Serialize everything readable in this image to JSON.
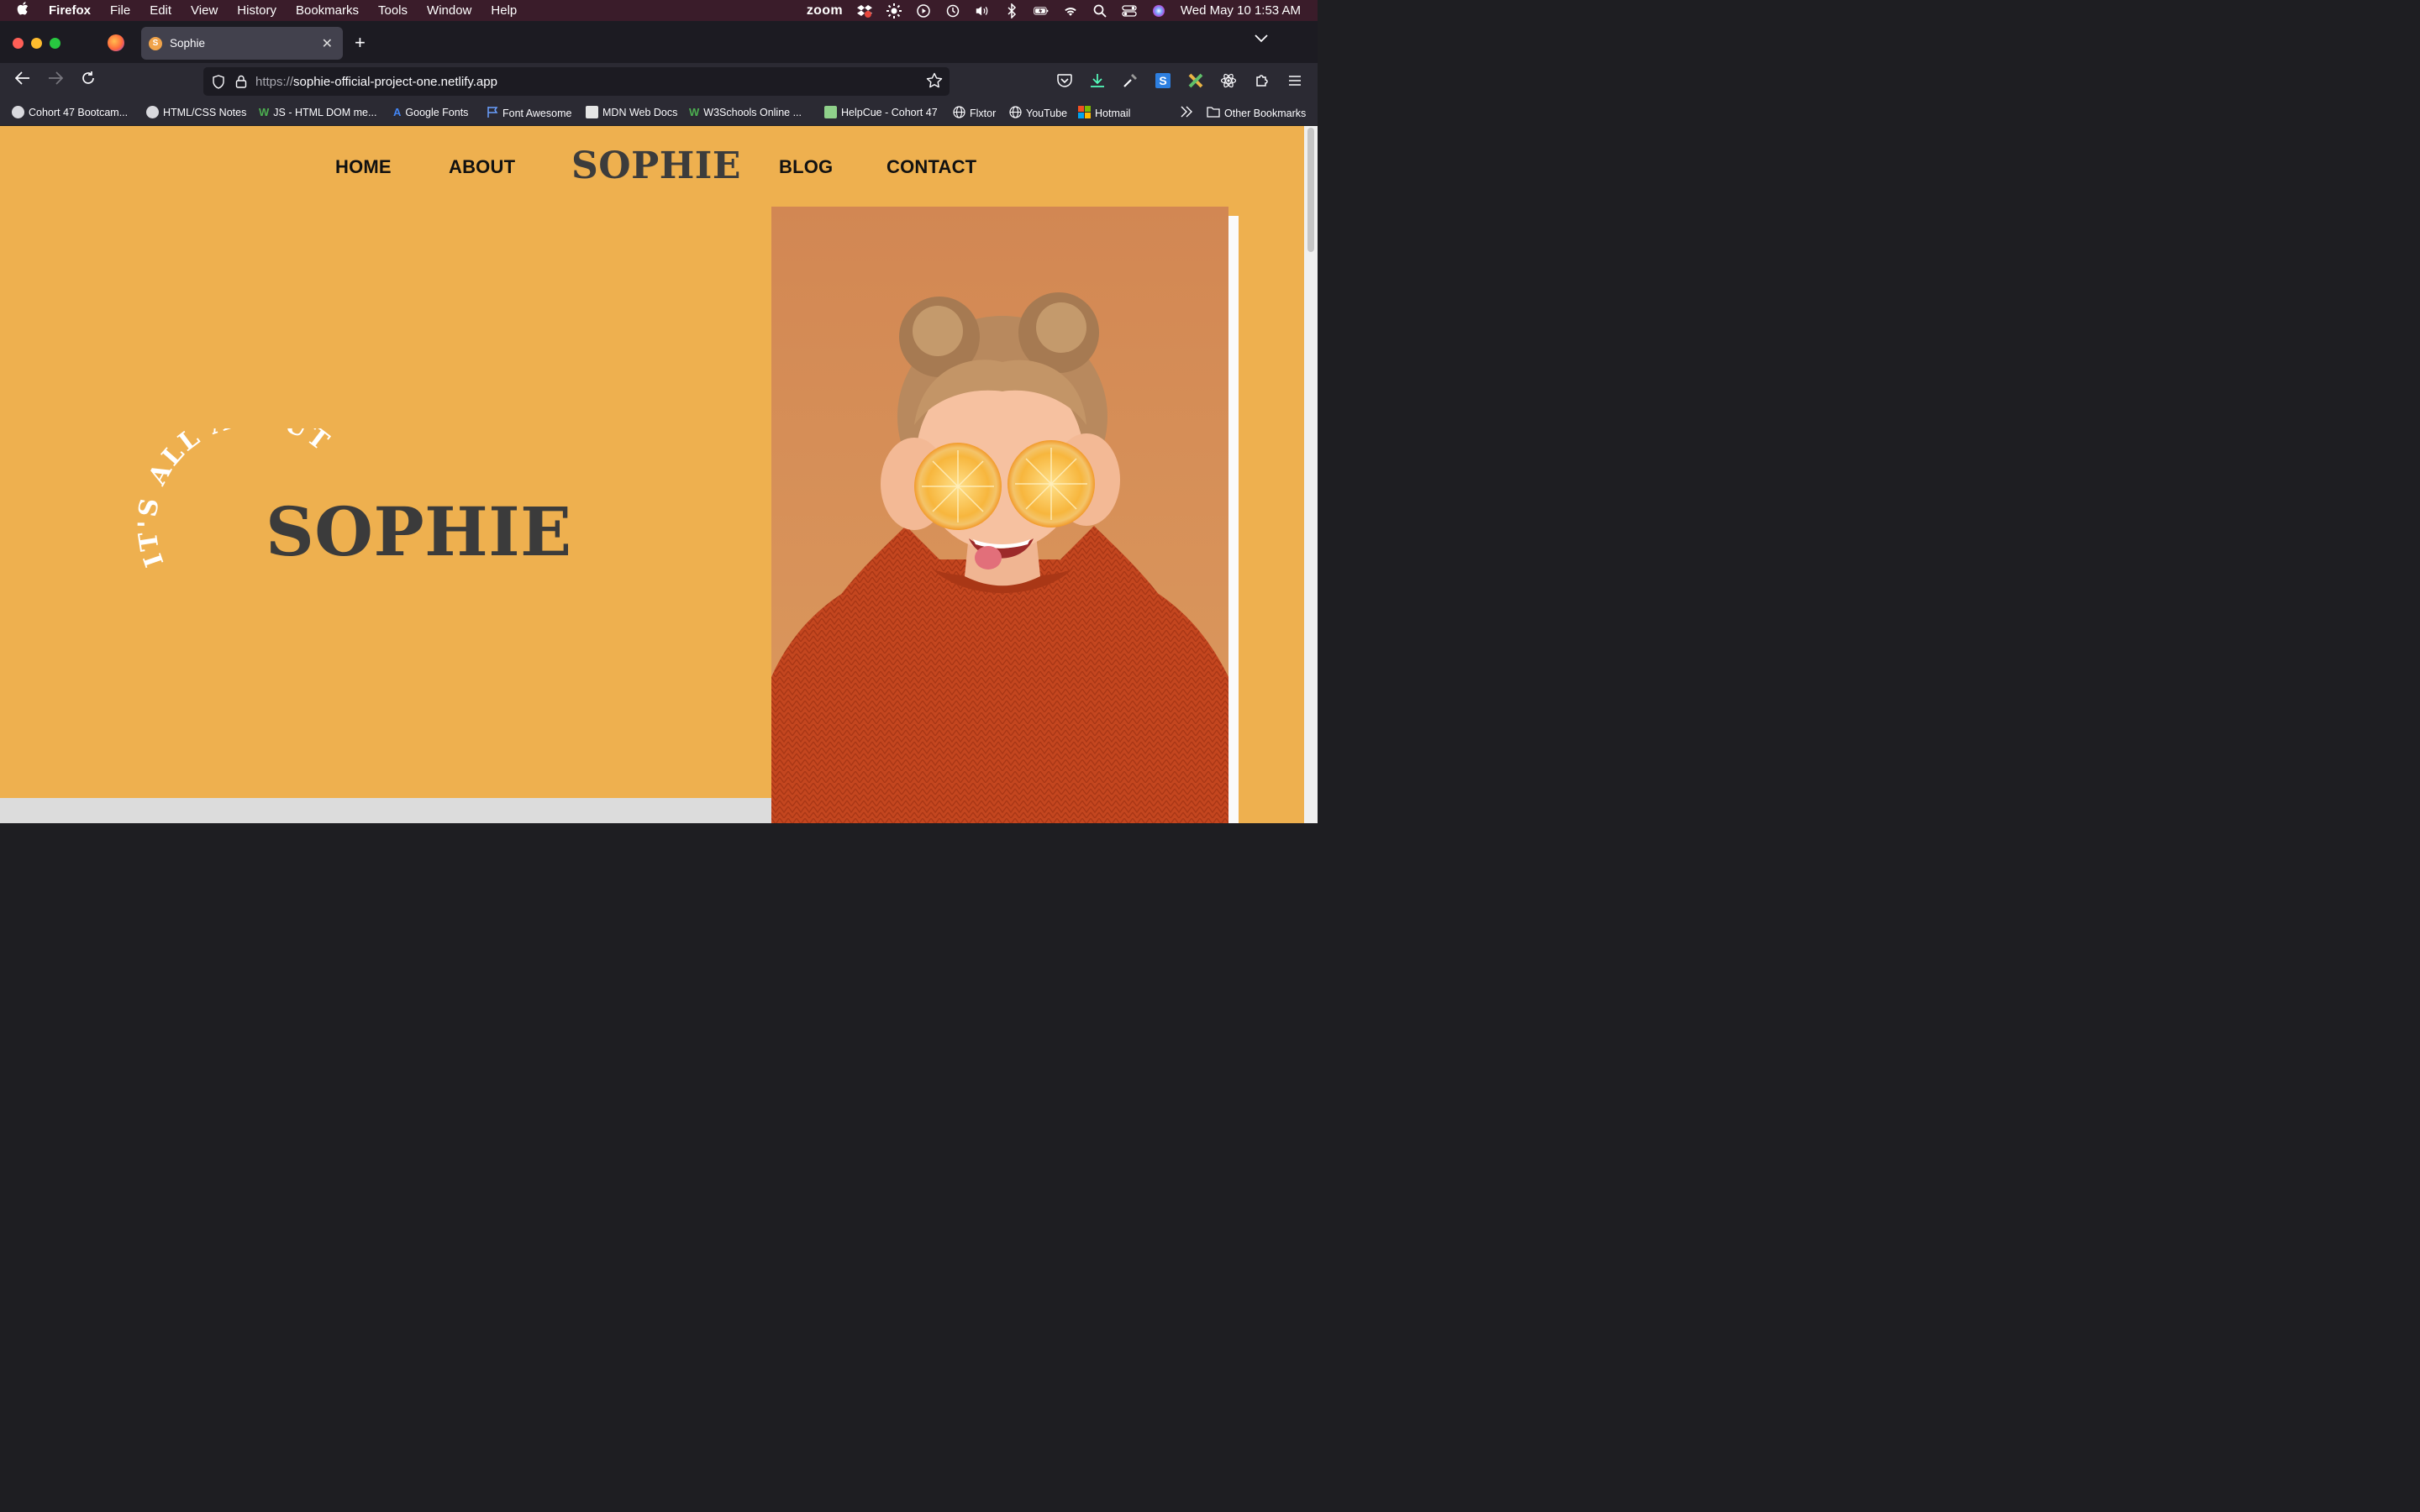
{
  "menubar": {
    "app": "Firefox",
    "items": [
      "File",
      "Edit",
      "View",
      "History",
      "Bookmarks",
      "Tools",
      "Window",
      "Help"
    ],
    "zoom": "zoom",
    "datetime": "Wed May 10  1:53 AM"
  },
  "browser": {
    "tab_title": "Sophie",
    "tab_favicon": "S",
    "url_scheme": "https://",
    "url_host": "sophie-official-project-one.netlify.app"
  },
  "bookmarks": [
    "Cohort 47 Bootcam...",
    "HTML/CSS Notes",
    "JS - HTML DOM me...",
    "Google Fonts",
    "Font Awesome",
    "MDN Web Docs",
    "W3Schools Online ...",
    "HelpCue - Cohort 47",
    "Flxtor",
    "YouTube",
    "Hotmail"
  ],
  "other_bookmarks": "Other Bookmarks",
  "site": {
    "nav": {
      "home": "HOME",
      "about": "ABOUT",
      "logo": "SOPHIE",
      "blog": "BLOG",
      "contact": "CONTACT"
    },
    "hero": {
      "arc_text": "IT'S ALL ABOUT",
      "title": "SOPHIE"
    }
  },
  "colors": {
    "page_bg": "#eeb04f",
    "photo_bg": "#d4844f",
    "sweater": "#c8481f",
    "menubar": "#3a1c2a"
  }
}
